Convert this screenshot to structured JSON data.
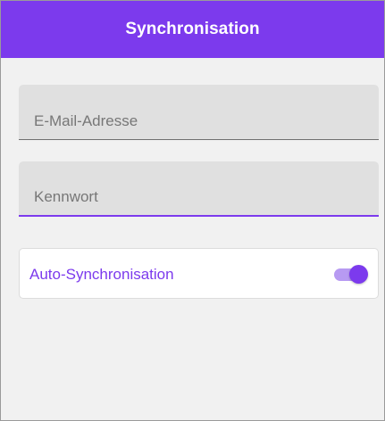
{
  "appbar": {
    "title": "Synchronisation"
  },
  "form": {
    "email": {
      "placeholder": "E-Mail-Adresse",
      "value": ""
    },
    "password": {
      "placeholder": "Kennwort",
      "value": ""
    },
    "auto_sync": {
      "label": "Auto-Synchronisation",
      "enabled": true
    }
  },
  "colors": {
    "accent": "#7c3aed",
    "accent_light": "#b79af2",
    "background": "#f1f1f1",
    "field_background": "#e0e0e0"
  }
}
